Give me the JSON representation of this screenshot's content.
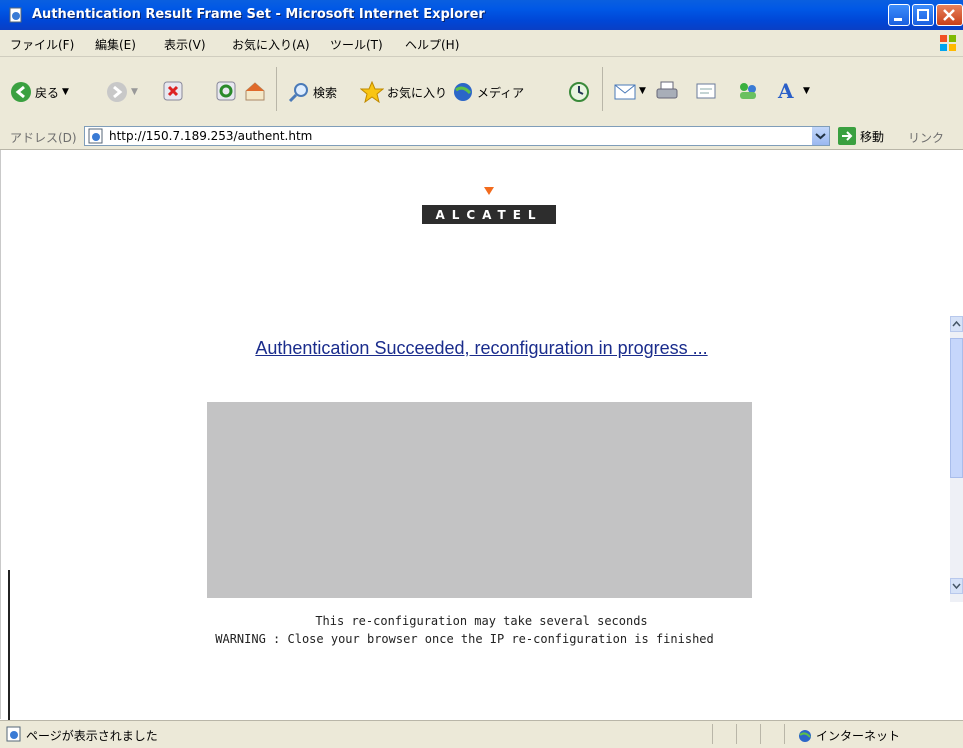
{
  "window": {
    "title": "Authentication Result Frame Set - Microsoft Internet Explorer"
  },
  "menu": {
    "items": [
      "ファイル(F)",
      "編集(E)",
      "表示(V)",
      "お気に入り(A)",
      "ツール(T)",
      "ヘルプ(H)"
    ]
  },
  "toolbar": {
    "back_label": "戻る",
    "search_label": "検索",
    "favorites_label": "お気に入り",
    "media_label": "メディア"
  },
  "address": {
    "label": "アドレス(D)",
    "url": "http://150.7.189.253/authent.htm",
    "go_label": "移動",
    "links_label": "リンク"
  },
  "content": {
    "logo_text": "ALCATEL",
    "heading_link": "Authentication Succeeded, reconfiguration in progress ...",
    "message_line1": "This re-configuration may take several seconds",
    "message_line2": "WARNING : Close your browser once the IP re-configuration is finished"
  },
  "status": {
    "text": "ページが表示されました",
    "zone": "インターネット"
  },
  "colors": {
    "titlebar": "#0058e6",
    "chrome": "#ece9d8",
    "link": "#1a2c8c",
    "frame_grey": "#c3c3c4",
    "logo_orange": "#f26b1d"
  }
}
